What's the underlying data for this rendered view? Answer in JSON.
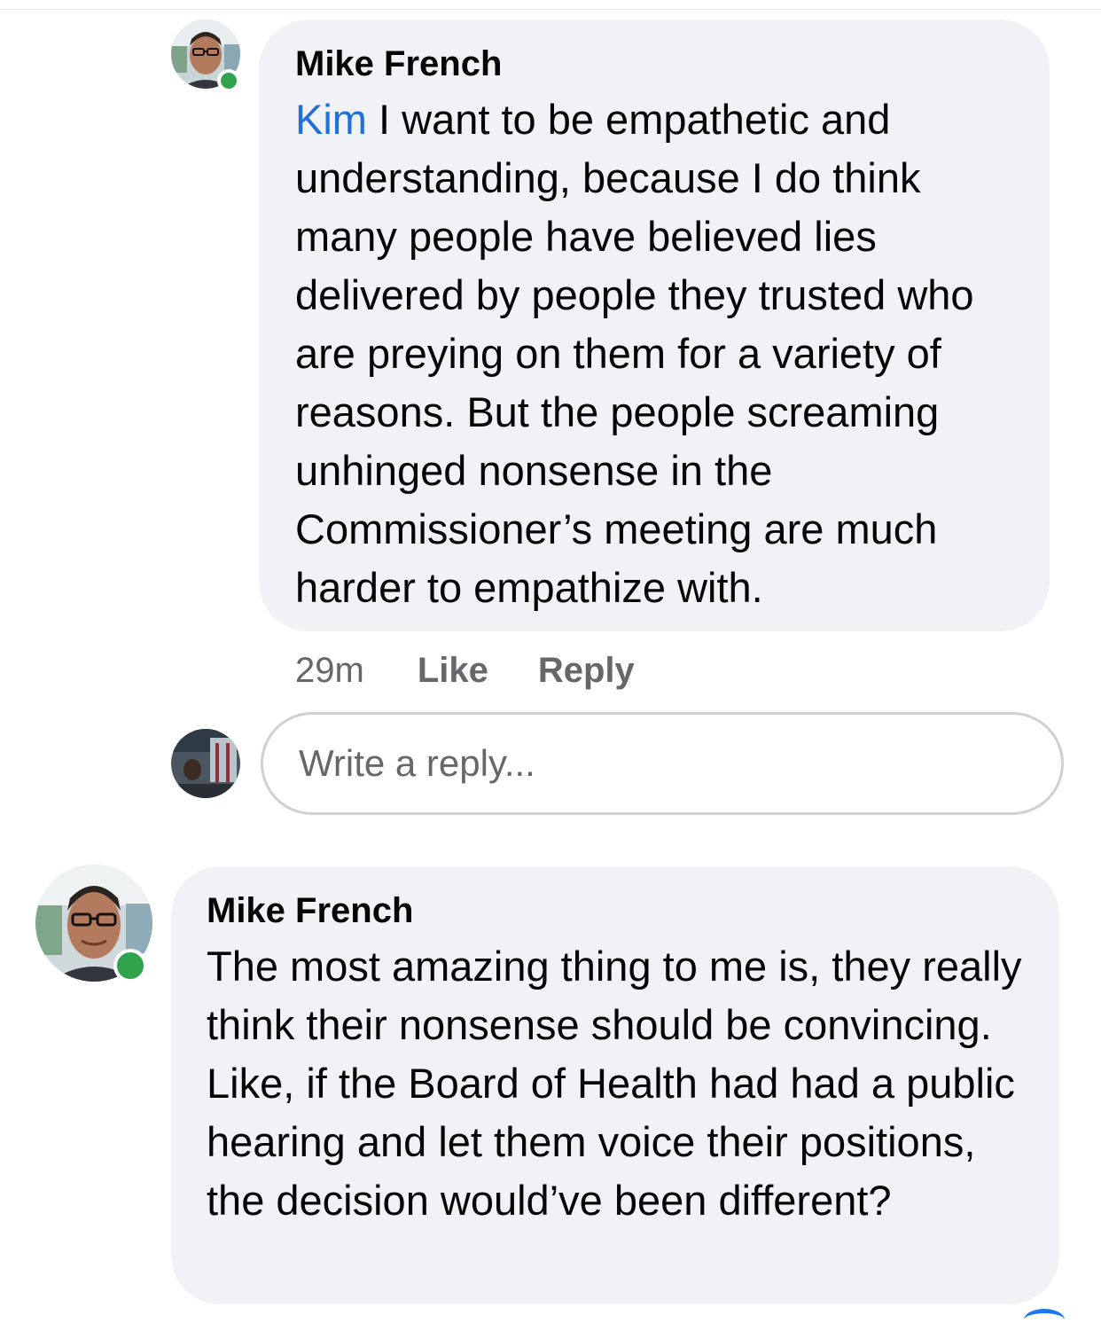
{
  "comment": {
    "author": "Mike French",
    "mention": "Kim",
    "text": " I want to be empathetic and understanding, because I do think many people have believed lies delivered by people they trusted who are preying on them for a variety of reasons. But the people screaming unhinged nonsense in the Commissioner’s meeting are much harder to empathize with.",
    "time": "29m",
    "like_label": "Like",
    "reply_label": "Reply",
    "author_online": true,
    "avatar_icon": "profile-photo-icon"
  },
  "reply_input": {
    "placeholder": "Write a reply...",
    "avatar_icon": "current-user-photo-icon"
  },
  "next_comment": {
    "author": "Mike French",
    "text": "The most amazing thing to me is, they really think their nonsense should be convincing. Like, if the Board of Health had had a public hearing and let them voice their positions, the decision would’ve been different?",
    "author_online": true,
    "avatar_icon": "profile-photo-icon"
  },
  "colors": {
    "bubble_bg": "#f0f2f5",
    "mention": "#216fdb",
    "online": "#31a24c",
    "meta": "#65676b",
    "input_border": "#ced0d4"
  }
}
